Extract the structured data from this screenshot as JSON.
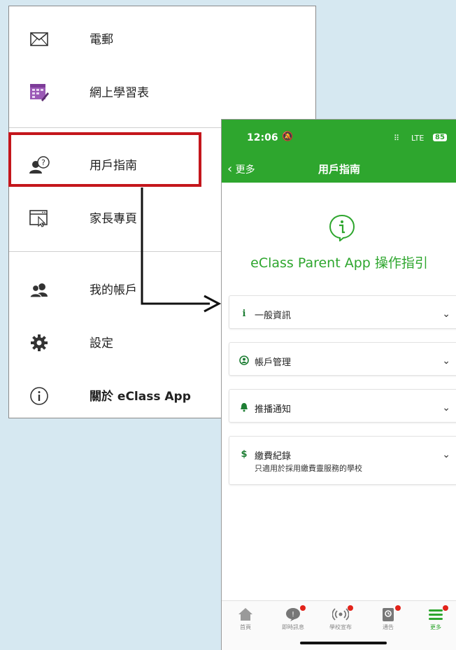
{
  "menu": {
    "items": [
      {
        "label": "電郵",
        "icon": "envelope-icon"
      },
      {
        "label": "網上學習表",
        "icon": "timetable-icon"
      },
      {
        "label": "用戶指南",
        "icon": "user-help-icon"
      },
      {
        "label": "家長專頁",
        "icon": "browser-click-icon"
      },
      {
        "label": "我的帳戶",
        "icon": "users-icon"
      },
      {
        "label": "設定",
        "icon": "gear-icon"
      },
      {
        "label": "關於 eClass App",
        "icon": "info-circle-icon"
      }
    ]
  },
  "status": {
    "time": "12:06",
    "network": "LTE",
    "battery": "85"
  },
  "nav": {
    "back_label": "更多",
    "title": "用戶指南"
  },
  "guide": {
    "title": "eClass Parent App 操作指引"
  },
  "sections": [
    {
      "icon": "info-icon",
      "title": "一般資訊",
      "subtitle": ""
    },
    {
      "icon": "account-circle-icon",
      "title": "帳戶管理",
      "subtitle": ""
    },
    {
      "icon": "bell-icon",
      "title": "推播通知",
      "subtitle": ""
    },
    {
      "icon": "dollar-icon",
      "title": "繳費紀錄",
      "subtitle": "只適用於採用繳費靈服務的學校"
    }
  ],
  "tabs": [
    {
      "label": "首頁",
      "icon": "home-icon",
      "badge": false,
      "active": false
    },
    {
      "label": "即時訊息",
      "icon": "chat-icon",
      "badge": true,
      "active": false
    },
    {
      "label": "學校宣布",
      "icon": "broadcast-icon",
      "badge": true,
      "active": false
    },
    {
      "label": "通告",
      "icon": "notice-icon",
      "badge": true,
      "active": false
    },
    {
      "label": "更多",
      "icon": "menu-icon",
      "badge": true,
      "active": true
    }
  ],
  "colors": {
    "brand_green": "#2ea62e",
    "highlight_red": "#c4161c",
    "badge_red": "#e2231a"
  }
}
